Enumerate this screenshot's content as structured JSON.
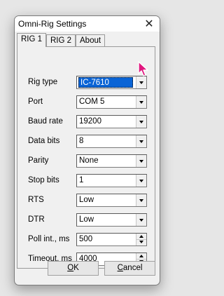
{
  "window": {
    "title": "Omni-Rig Settings",
    "close_glyph": "✕"
  },
  "tabs": [
    {
      "label": "RIG 1",
      "active": true
    },
    {
      "label": "RIG 2",
      "active": false
    },
    {
      "label": "About",
      "active": false
    }
  ],
  "fields": {
    "rig_type": {
      "label": "Rig type",
      "value": "IC-7610"
    },
    "port": {
      "label": "Port",
      "value": "COM 5"
    },
    "baud_rate": {
      "label": "Baud rate",
      "value": "19200"
    },
    "data_bits": {
      "label": "Data bits",
      "value": "8"
    },
    "parity": {
      "label": "Parity",
      "value": "None"
    },
    "stop_bits": {
      "label": "Stop bits",
      "value": "1"
    },
    "rts": {
      "label": "RTS",
      "value": "Low"
    },
    "dtr": {
      "label": "DTR",
      "value": "Low"
    },
    "poll_int": {
      "label": "Poll int., ms",
      "value": "500"
    },
    "timeout": {
      "label": "Timeout, ms",
      "value": "4000"
    }
  },
  "buttons": {
    "ok": {
      "accel": "O",
      "rest": "K"
    },
    "cancel": {
      "accel": "C",
      "rest": "ancel"
    }
  },
  "colors": {
    "selection": "#0a64d6",
    "cursor": "#e0177f"
  }
}
